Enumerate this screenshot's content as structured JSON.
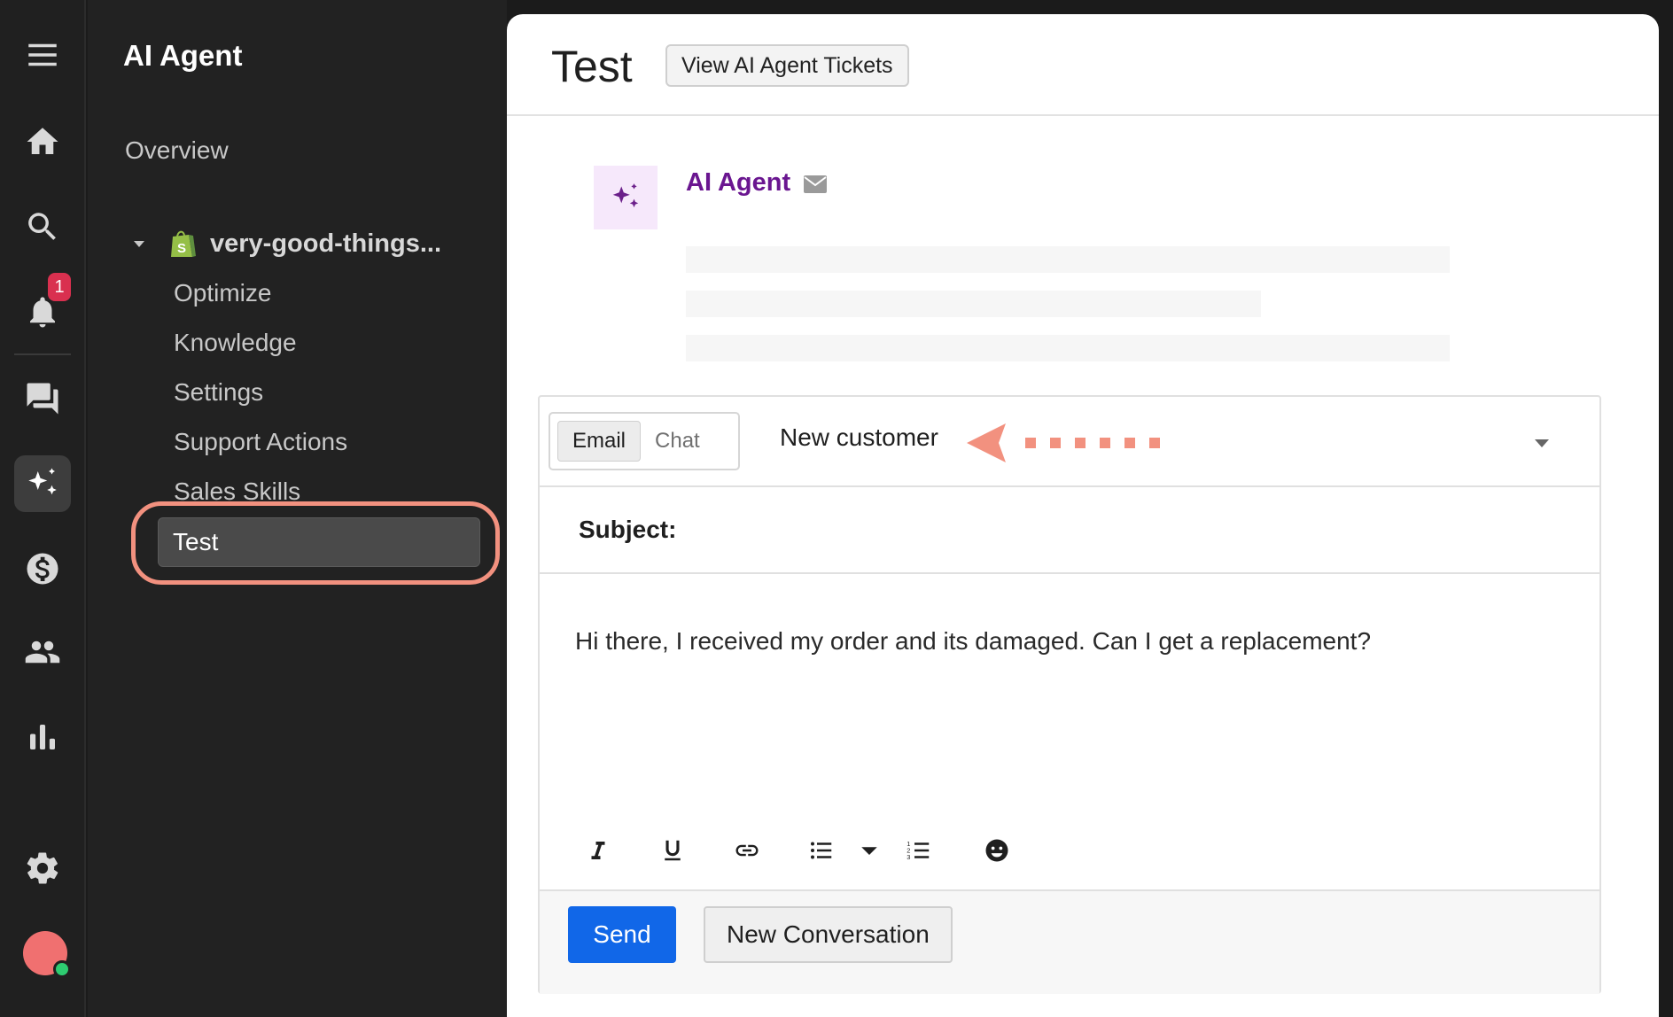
{
  "rail": {
    "notification_count": "1"
  },
  "nav": {
    "title": "AI Agent",
    "overview": "Overview",
    "store_name": "very-good-things...",
    "items": [
      {
        "label": "Optimize"
      },
      {
        "label": "Knowledge"
      },
      {
        "label": "Settings"
      },
      {
        "label": "Support Actions"
      },
      {
        "label": "Sales Skills"
      }
    ],
    "selected": "Test"
  },
  "main": {
    "title": "Test",
    "tickets_button": "View AI Agent Tickets",
    "agent_name": "AI Agent"
  },
  "composer": {
    "channels": [
      "Email",
      "Chat"
    ],
    "active_channel": "Email",
    "customer": "New customer",
    "subject_label": "Subject:",
    "body": "Hi there, I received my order and its damaged. Can I get a replacement?",
    "send_label": "Send",
    "new_conversation_label": "New Conversation"
  },
  "colors": {
    "accent_blue": "#1167e8",
    "agent_purple": "#6a1690",
    "highlight": "#f2917f",
    "badge_red": "#d9304f"
  }
}
